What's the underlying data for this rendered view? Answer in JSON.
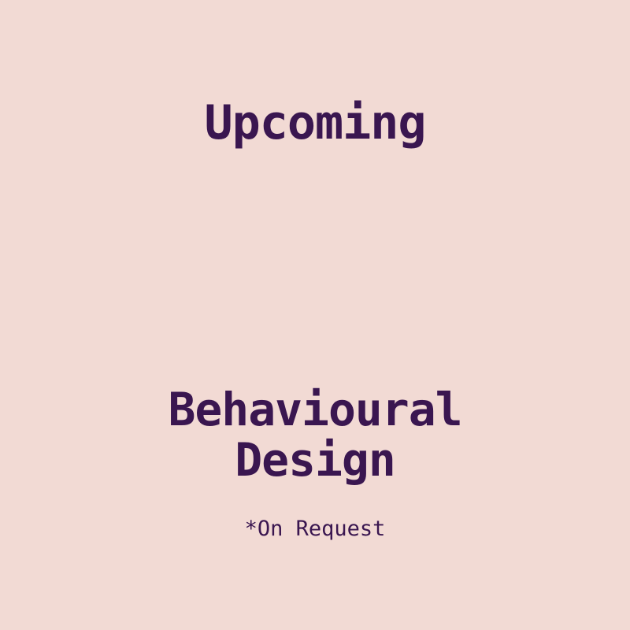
{
  "status_heading": "Upcoming",
  "course_title_line1": "Behavioural",
  "course_title_line2": "Design",
  "availability_note": "*On Request",
  "colors": {
    "background": "#f2dad4",
    "text": "#3a1650"
  }
}
